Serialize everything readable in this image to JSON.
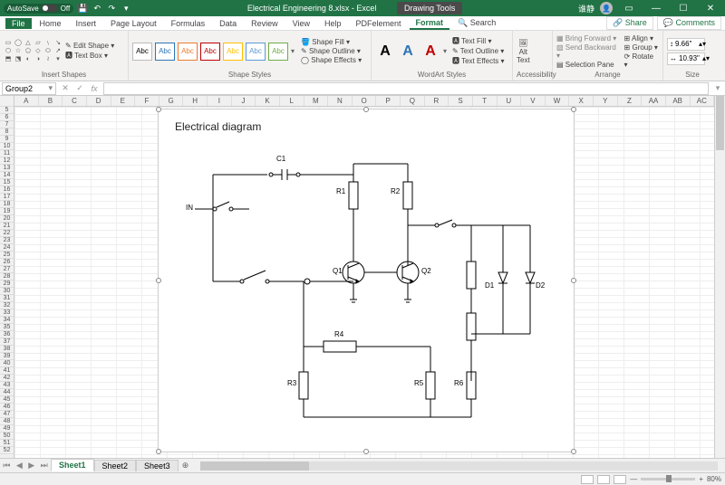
{
  "titlebar": {
    "autosave_label": "AutoSave",
    "autosave_state": "Off",
    "doc_title": "Electrical Engineering 8.xlsx - Excel",
    "context_label": "Drawing Tools",
    "user_label": "谁静"
  },
  "menu": {
    "tabs": [
      "File",
      "Home",
      "Insert",
      "Page Layout",
      "Formulas",
      "Data",
      "Review",
      "View",
      "Help",
      "PDFelement",
      "Format"
    ],
    "active": "Format",
    "search_label": "Search",
    "share": "Share",
    "comments": "Comments"
  },
  "ribbon": {
    "insert_shapes": {
      "edit_shape": "Edit Shape",
      "text_box": "Text Box",
      "label": "Insert Shapes"
    },
    "shape_styles": {
      "swatch": "Abc",
      "fill": "Shape Fill",
      "outline": "Shape Outline",
      "effects": "Shape Effects",
      "label": "Shape Styles"
    },
    "wordart": {
      "glyph": "A",
      "tfill": "Text Fill",
      "toutline": "Text Outline",
      "teffects": "Text Effects",
      "label": "WordArt Styles"
    },
    "accessibility": {
      "alt": "Alt\nText",
      "label": "Accessibility"
    },
    "arrange": {
      "bring": "Bring Forward",
      "send": "Send Backward",
      "sel": "Selection Pane",
      "align": "Align",
      "group": "Group",
      "rotate": "Rotate",
      "label": "Arrange"
    },
    "size": {
      "h": "9.66\"",
      "w": "10.93\"",
      "label": "Size"
    }
  },
  "formula": {
    "namebox": "Group2"
  },
  "columns": [
    "A",
    "B",
    "C",
    "D",
    "E",
    "F",
    "G",
    "H",
    "I",
    "J",
    "K",
    "L",
    "M",
    "N",
    "O",
    "P",
    "Q",
    "R",
    "S",
    "T",
    "U",
    "V",
    "W",
    "X",
    "Y",
    "Z",
    "AA",
    "AB",
    "AC"
  ],
  "row_start": 5,
  "row_end": 52,
  "diagram": {
    "title": "Electrical diagram",
    "labels": {
      "IN": "IN",
      "C1": "C1",
      "R1": "R1",
      "R2": "R2",
      "Q1": "Q1",
      "Q2": "Q2",
      "D1": "D1",
      "D2": "D2",
      "R3": "R3",
      "R4": "R4",
      "R5": "R5",
      "R6": "R6"
    }
  },
  "sheets": {
    "tabs": [
      "Sheet1",
      "Sheet2",
      "Sheet3"
    ],
    "active": "Sheet1"
  },
  "status": {
    "zoom": "80%"
  }
}
